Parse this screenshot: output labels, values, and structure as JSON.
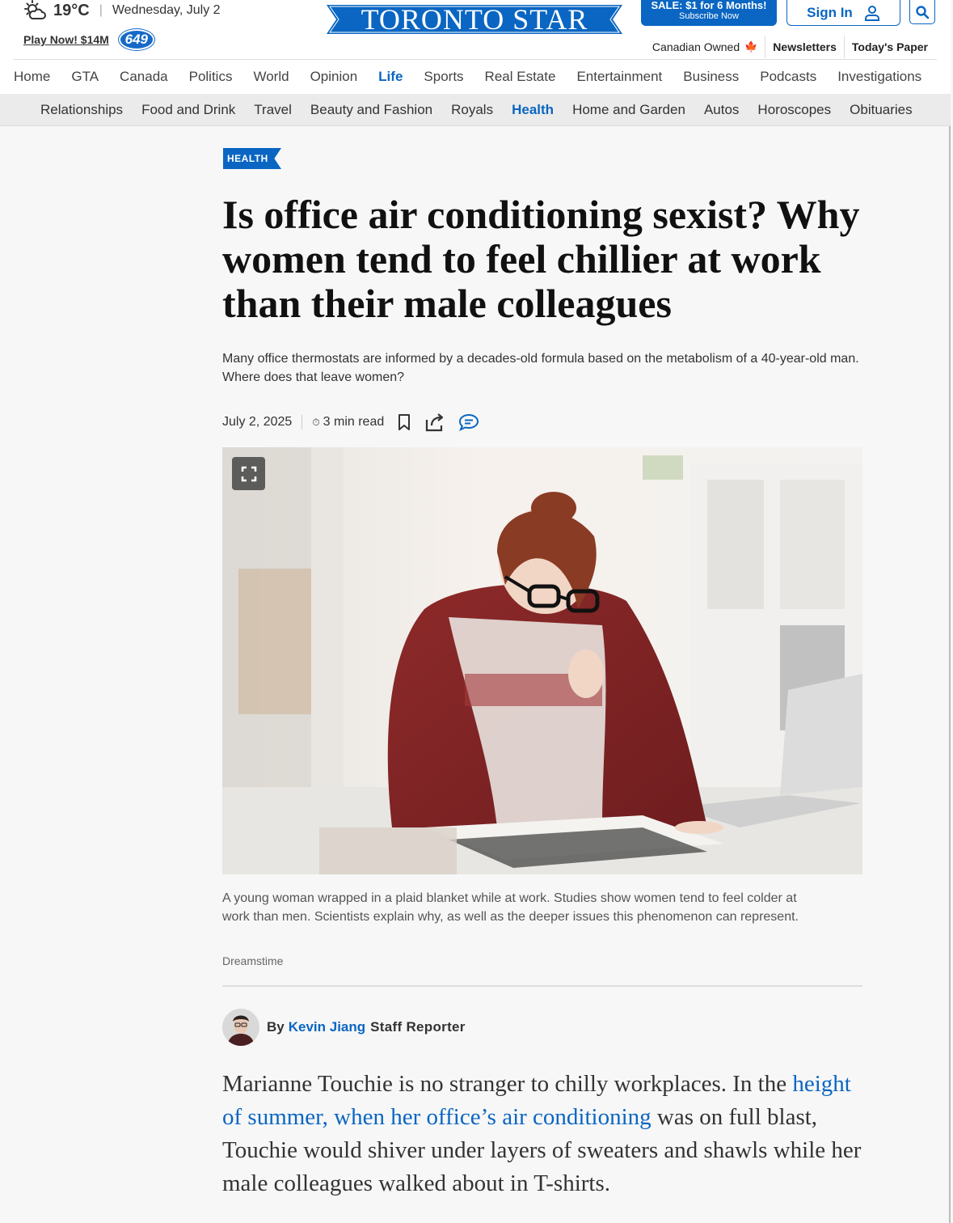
{
  "header": {
    "temperature": "19°C",
    "date": "Wednesday, July 2",
    "lotto_link": "Play Now! $14M",
    "lotto_badge": "649",
    "logo": "TORONTO STAR",
    "sale_title": "SALE: $1 for 6 Months!",
    "sale_sub": "Subscribe Now",
    "sign_in": "Sign In",
    "utility": {
      "canadian_owned": "Canadian Owned",
      "newsletters": "Newsletters",
      "todays_paper": "Today's Paper"
    }
  },
  "nav": {
    "items": [
      "Home",
      "GTA",
      "Canada",
      "Politics",
      "World",
      "Opinion",
      "Life",
      "Sports",
      "Real Estate",
      "Entertainment",
      "Business",
      "Podcasts",
      "Investigations"
    ],
    "active": "Life"
  },
  "subnav": {
    "items": [
      "Relationships",
      "Food and Drink",
      "Travel",
      "Beauty and Fashion",
      "Royals",
      "Health",
      "Home and Garden",
      "Autos",
      "Horoscopes",
      "Obituaries"
    ],
    "active": "Health"
  },
  "article": {
    "tag": "HEALTH",
    "headline": "Is office air conditioning sexist? Why women tend to feel chillier at work than their male colleagues",
    "dek": "Many office thermostats are informed by a decades-old formula based on the metabolism of a 40-year-old man. Where does that leave women?",
    "date": "July 2, 2025",
    "read_time": "3 min read",
    "caption": "A young woman wrapped in a plaid blanket while at work. Studies show women tend to feel colder at work than men. Scientists explain why, as well as the deeper issues this phenomenon can represent.",
    "credit": "Dreamstime",
    "byline_prefix": "By",
    "author": "Kevin Jiang",
    "author_role": "Staff Reporter",
    "body_p1_start": "Marianne Touchie is no stranger to chilly workplaces. In the ",
    "body_p1_link": "height of summer, when her office’s air conditioning",
    "body_p1_end": " was on full blast, Touchie would shiver under layers of sweaters and shawls while her male colleagues walked about in T-shirts."
  },
  "colors": {
    "accent": "#0a66c2",
    "maple": "#d0141d"
  }
}
